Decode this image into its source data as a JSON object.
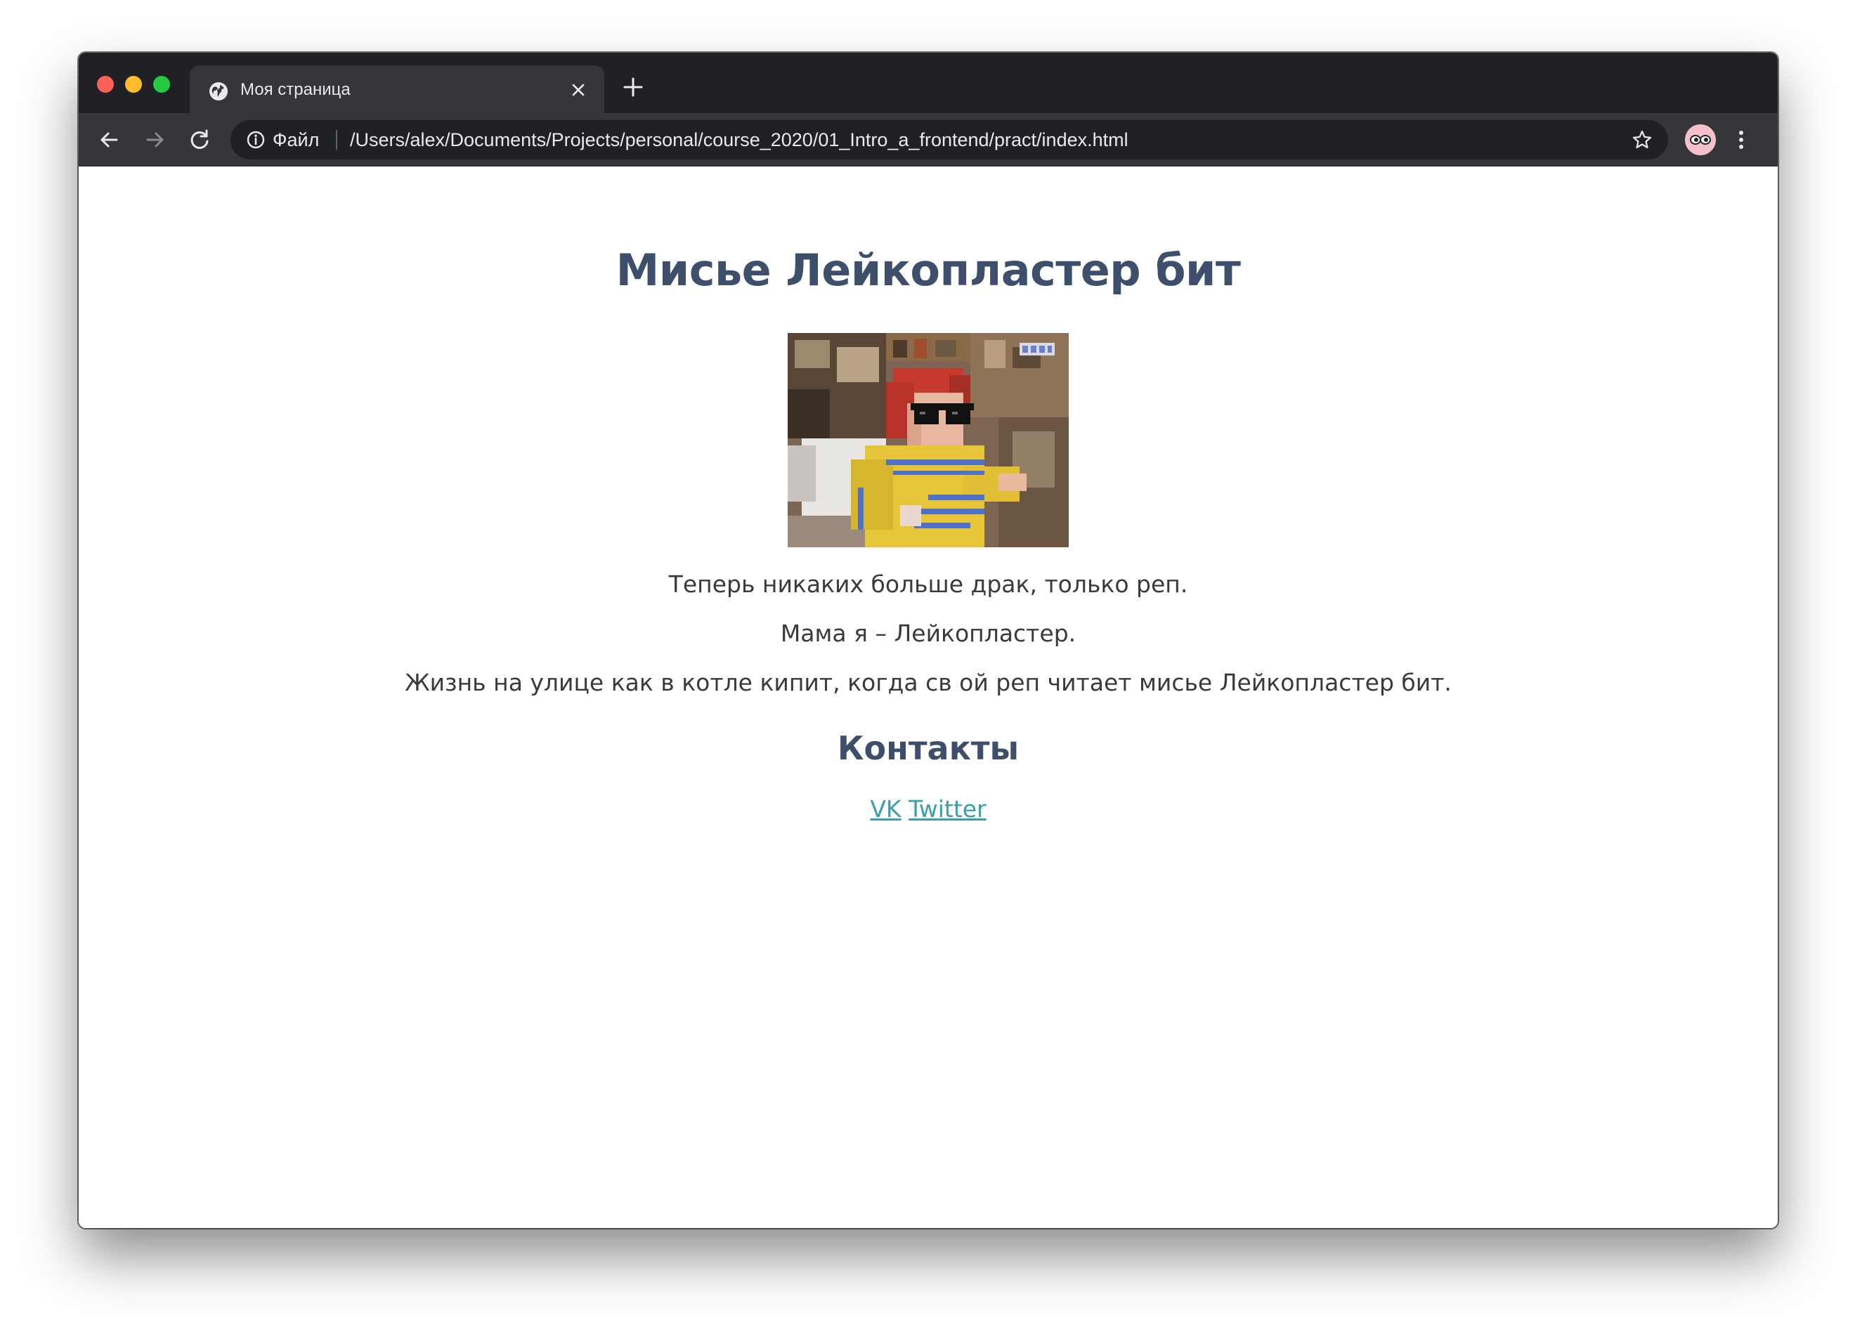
{
  "browser": {
    "tab": {
      "title": "Моя страница"
    },
    "toolbar": {
      "scheme_label": "Файл",
      "url": "/Users/alex/Documents/Projects/personal/course_2020/01_Intro_a_frontend/pract/index.html"
    },
    "colors": {
      "chrome_dark": "#202124",
      "chrome_mid": "#35363a",
      "text_light": "#e8eaed",
      "close_red": "#fe5f57",
      "minimize_yellow": "#febc2e",
      "maximize_green": "#28c840"
    }
  },
  "page": {
    "title": "Мисье Лейкопластер бит",
    "image": {
      "icon": "pixel-art-character-image"
    },
    "paragraphs": [
      "Теперь никаких больше драк, только реп.",
      "Мама я – Лейкопластер.",
      "Жизнь на улице как в котле кипит, когда св ой реп читает мисье Лейкопластер бит."
    ],
    "contacts_title": "Контакты",
    "links": [
      {
        "label": "VK"
      },
      {
        "label": "Twitter"
      }
    ],
    "colors": {
      "heading": "#3d4f6b",
      "text": "#3a3a3a",
      "link": "#3a9fa9"
    }
  }
}
